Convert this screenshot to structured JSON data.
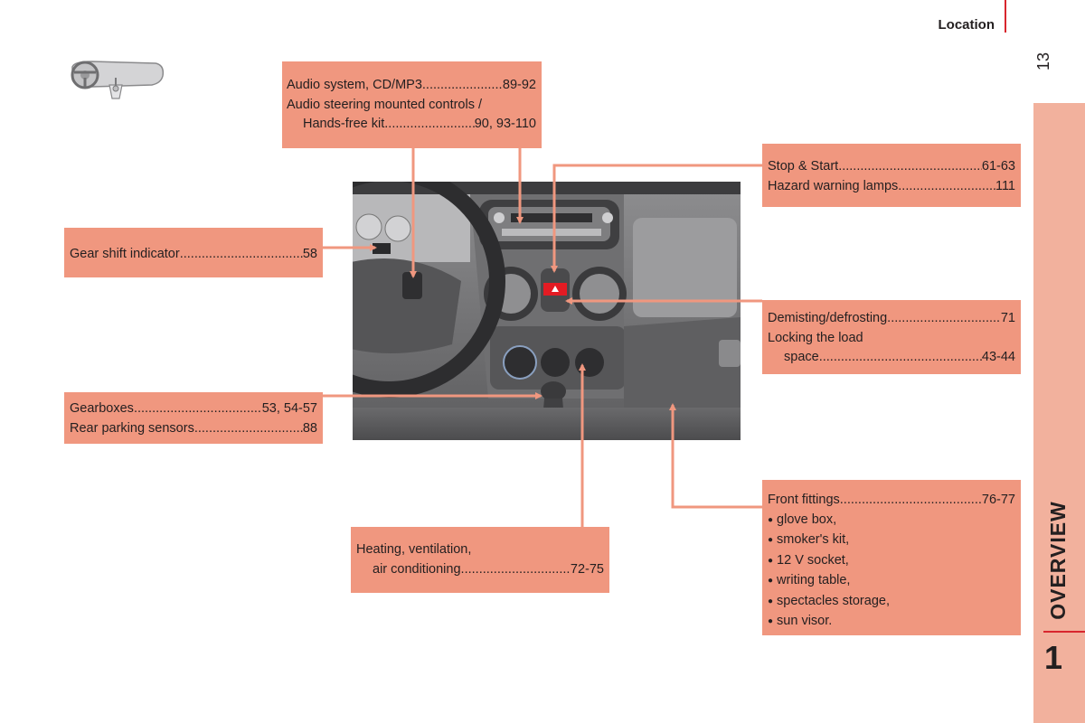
{
  "header": {
    "section_title": "Location",
    "page_number": "13"
  },
  "side_tab": {
    "label": "OVERVIEW",
    "chapter_number": "1"
  },
  "car_icon": "steering-wheel-and-gear-lever-icon",
  "colors": {
    "callout_bg": "#f0977f",
    "side_tab_bg": "#f2b19d",
    "accent_red": "#d8262e",
    "leader_line": "#f0977f"
  },
  "callouts": {
    "audio": {
      "rows": [
        {
          "label": "Audio system, CD/MP3 ",
          "pages": "89-92"
        },
        {
          "label": "Audio steering mounted controls /",
          "pages": ""
        },
        {
          "label": "Hands-free kit ",
          "pages": "90, 93-110"
        }
      ]
    },
    "stop_start": {
      "rows": [
        {
          "label": "Stop & Start ",
          "pages": "61-63"
        },
        {
          "label": "Hazard warning lamps",
          "pages": " 111"
        }
      ]
    },
    "gear_shift": {
      "rows": [
        {
          "label": "Gear shift indicator ",
          "pages": "58"
        }
      ]
    },
    "demisting": {
      "rows": [
        {
          "label": "Demisting/defrosting",
          "pages": "71"
        },
        {
          "label": "Locking the load",
          "pages": ""
        },
        {
          "label": "space ",
          "pages": "43-44"
        }
      ]
    },
    "gearboxes": {
      "rows": [
        {
          "label": "Gearboxes",
          "pages": "53, 54-57"
        },
        {
          "label": "Rear parking sensors ",
          "pages": "88"
        }
      ]
    },
    "heating": {
      "rows": [
        {
          "label": "Heating, ventilation,",
          "pages": ""
        },
        {
          "label": "air conditioning ",
          "pages": "72-75"
        }
      ]
    },
    "front_fittings": {
      "rows": [
        {
          "label": "Front fittings",
          "pages": "76-77"
        }
      ],
      "bullets": [
        "glove box,",
        "smoker's kit,",
        "12 V socket,",
        "writing table,",
        "spectacles storage,",
        "sun visor."
      ]
    }
  },
  "photo": {
    "subject": "dashboard-interior-illustration"
  }
}
